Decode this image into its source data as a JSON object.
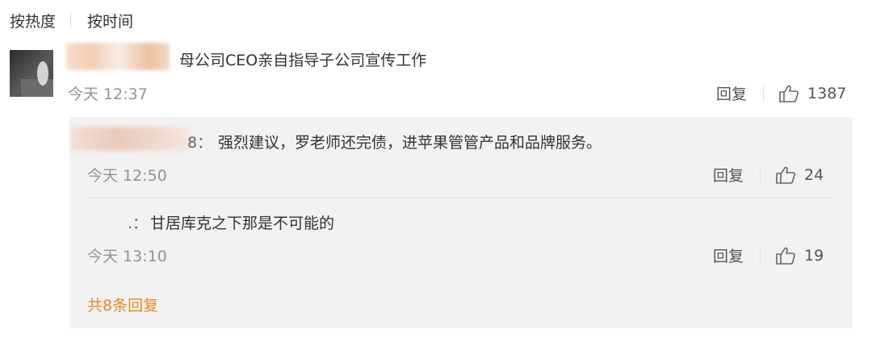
{
  "sort": {
    "hot": "按热度",
    "time": "按时间"
  },
  "main_comment": {
    "text": "母公司CEO亲自指导子公司宣传工作",
    "time": "今天 12:37",
    "reply_label": "回复",
    "likes": "1387"
  },
  "replies": [
    {
      "author_visible": "8：",
      "text": "强烈建议，罗老师还完债，进苹果管管产品和品牌服务。",
      "time": "今天 12:50",
      "reply_label": "回复",
      "likes": "24"
    },
    {
      "author_visible": ".：",
      "text": "甘居库克之下那是不可能的",
      "time": "今天 13:10",
      "reply_label": "回复",
      "likes": "19"
    }
  ],
  "more_replies": "共8条回复",
  "colors": {
    "accent": "#e8882b",
    "muted": "#939393",
    "reply_bg": "#f2f2f2"
  },
  "icons": {
    "like": "thumbs-up-icon"
  }
}
